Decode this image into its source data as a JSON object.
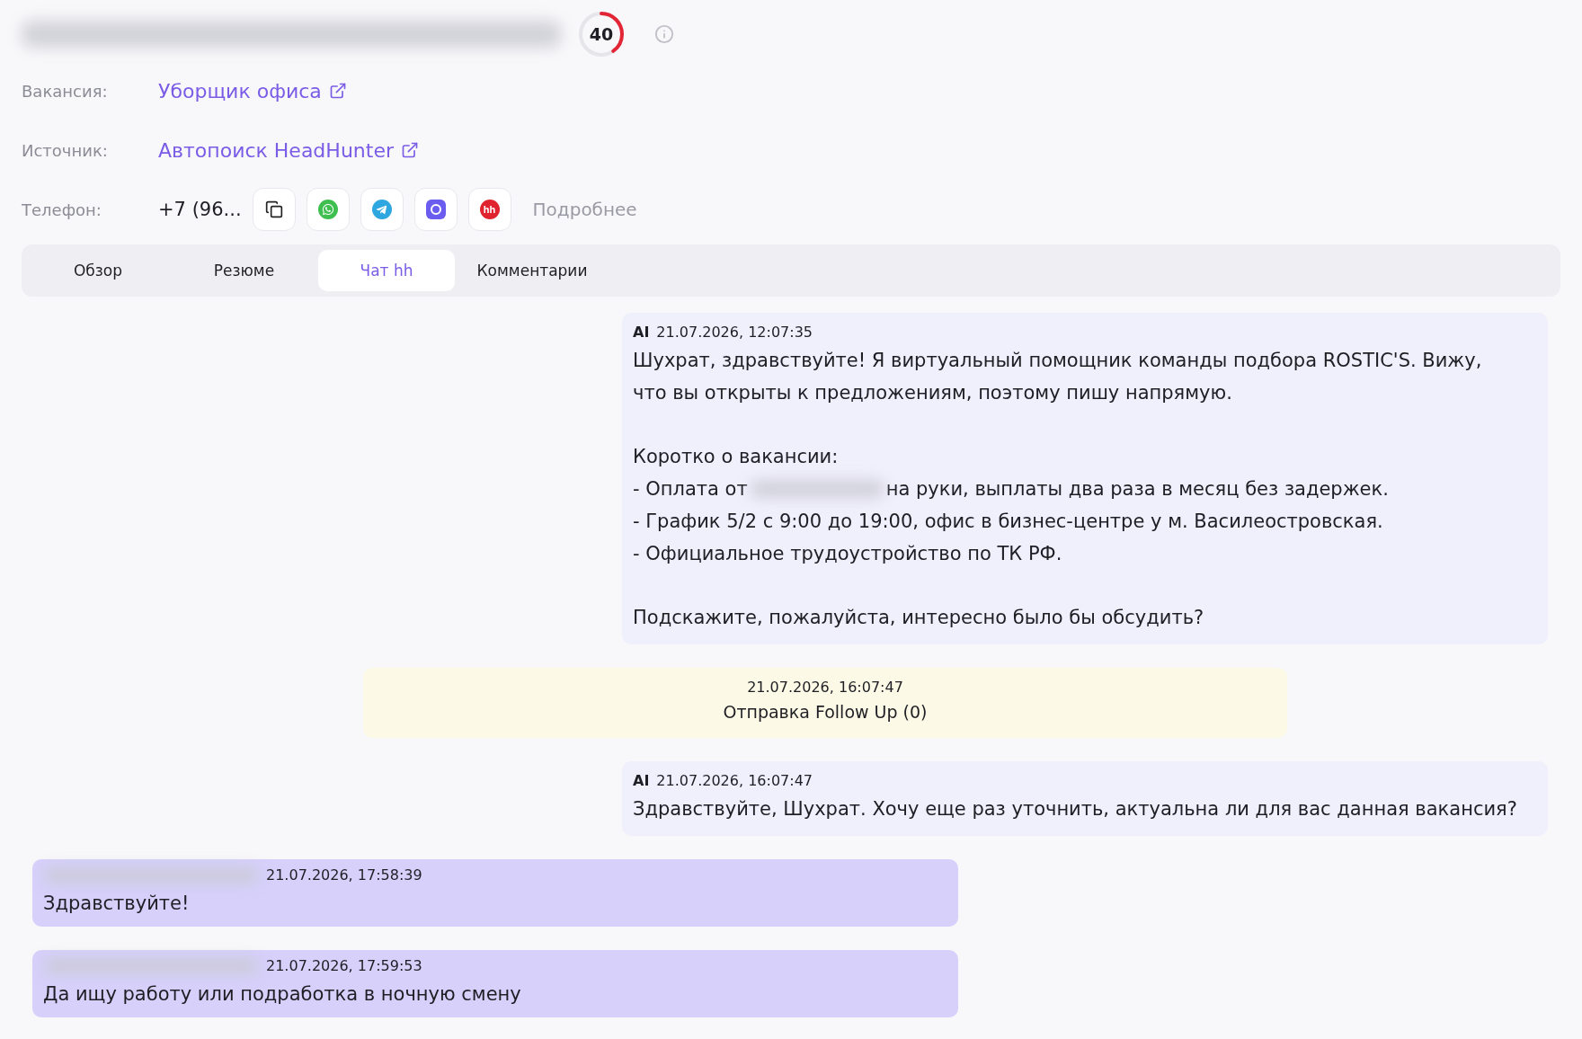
{
  "header": {
    "score": {
      "value": "40",
      "level": 0.4
    }
  },
  "fields": [
    {
      "kind": "link",
      "label": "Вакансия:",
      "value": "Уборщик офиса"
    },
    {
      "kind": "link",
      "label": "Источник:",
      "value": "Автопоиск HeadHunter"
    },
    {
      "kind": "phone",
      "label": "Телефон:",
      "value": "+7 (96...",
      "hh_logo": "hh",
      "more": "Подробнее"
    }
  ],
  "tabs": [
    {
      "label": "Обзор",
      "selected": false
    },
    {
      "label": "Резюме",
      "selected": false
    },
    {
      "label": "Чат hh",
      "selected": true
    },
    {
      "label": "Комментарии",
      "selected": false
    }
  ],
  "messages": [
    {
      "kind": "ai",
      "author": "AI",
      "time": "21.07.2026, 12:07:35",
      "lines": [
        {
          "kind": "text",
          "text": "Шухрат, здравствуйте! Я виртуальный помощник команды подбора ROSTIC'S. Вижу,"
        },
        {
          "kind": "text",
          "text": "что вы открыты к предложениям, поэтому пишу напрямую."
        },
        {
          "kind": "blank"
        },
        {
          "kind": "text",
          "text": "Коротко о вакансии:"
        },
        {
          "kind": "redacted",
          "before": "- Оплата от",
          "after": "на руки, выплаты два раза в месяц без задержек."
        },
        {
          "kind": "text",
          "text": "- График 5/2 с 9:00 до 19:00, офис в бизнес-центре у м. Василеостровская."
        },
        {
          "kind": "text",
          "text": "- Официальное трудоустройство по ТК РФ."
        },
        {
          "kind": "blank"
        },
        {
          "kind": "text",
          "text": "Подскажите, пожалуйста, интересно было бы обсудить?"
        }
      ]
    },
    {
      "kind": "system",
      "time": "21.07.2026, 16:07:47",
      "lines": [
        {
          "kind": "text",
          "text": "Отправка Follow Up (0)"
        }
      ]
    },
    {
      "kind": "ai",
      "author": "AI",
      "time": "21.07.2026, 16:07:47",
      "lines": [
        {
          "kind": "text",
          "text": "Здравствуйте, Шухрат. Хочу еще раз уточнить, актуальна ли для вас данная вакансия?"
        }
      ]
    },
    {
      "kind": "user",
      "time": "21.07.2026, 17:58:39",
      "lines": [
        {
          "kind": "text",
          "text": "Здравствуйте!"
        }
      ]
    },
    {
      "kind": "user",
      "time": "21.07.2026, 17:59:53",
      "lines": [
        {
          "kind": "text",
          "text": "Да ищу работу или подработка в ночную смену"
        }
      ]
    }
  ]
}
